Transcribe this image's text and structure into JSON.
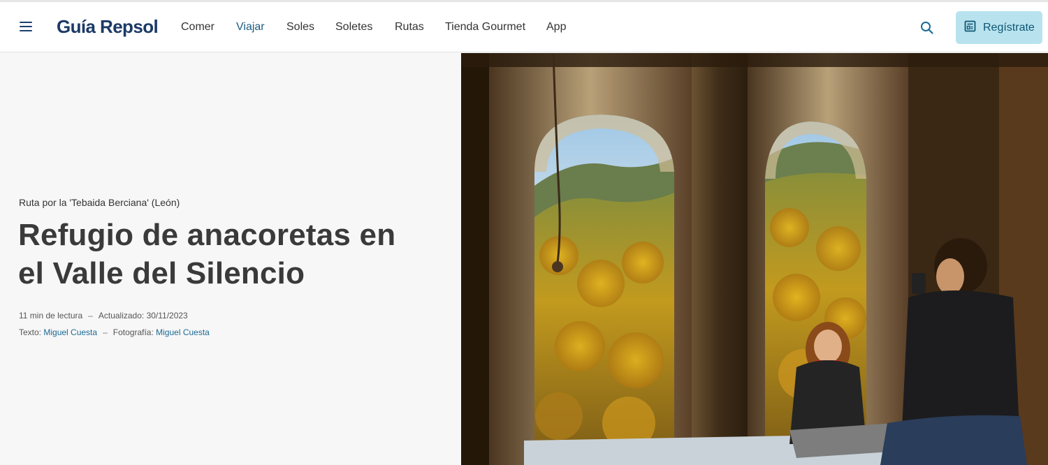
{
  "header": {
    "logo": "Guía Repsol",
    "nav": [
      {
        "label": "Comer",
        "active": false
      },
      {
        "label": "Viajar",
        "active": true
      },
      {
        "label": "Soles",
        "active": false
      },
      {
        "label": "Soletes",
        "active": false
      },
      {
        "label": "Rutas",
        "active": false
      },
      {
        "label": "Tienda Gourmet",
        "active": false
      },
      {
        "label": "App",
        "active": false
      }
    ],
    "register_label": "Regístrate",
    "icons": {
      "menu": "hamburger-menu-icon",
      "search": "search-icon",
      "register": "register-form-icon"
    }
  },
  "article": {
    "kicker": "Ruta por la 'Tebaida Berciana' (León)",
    "title": "Refugio de anacoretas en el Valle del Silencio",
    "reading_time": "11 min de lectura",
    "updated": "Actualizado: 30/11/2023",
    "text_label": "Texto:",
    "text_author": "Miguel Cuesta",
    "photo_label": "Fotografía:",
    "photo_author": "Miguel Cuesta"
  },
  "colors": {
    "brand": "#1c3a66",
    "active_nav": "#1a5c80",
    "register_bg": "#b8e3ee",
    "link": "#1a6a96"
  }
}
